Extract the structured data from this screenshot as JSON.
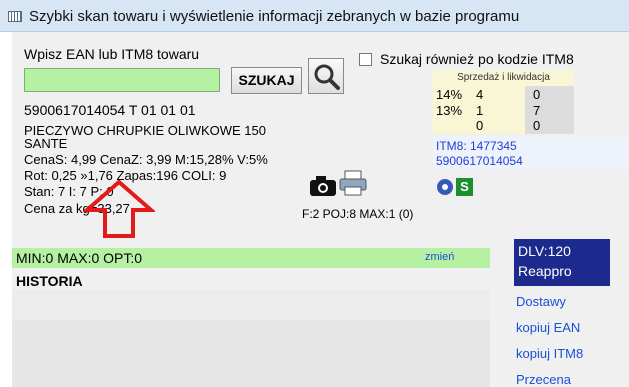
{
  "window": {
    "title": "Szybki skan towaru i wyświetlenie informacji zebranych w bazie programu"
  },
  "search": {
    "label": "Wpisz EAN lub ITM8 towaru",
    "input_value": "",
    "button_label": "SZUKAJ",
    "itm8_checkbox_label": "Szukaj również po kodzie ITM8",
    "itm8_checked": false
  },
  "product": {
    "line1": "5900617014054   T  01 01 01",
    "name": "PIECZYWO CHRUPKIE OLIWKOWE 150",
    "brand": "SANTE",
    "prices": "CenaS: 4,99   CenaZ: 3,99  M:15,28% V:5%",
    "rot": "Rot: 0,25 »1,76 Zapas:196   COLI: 9",
    "stan": "Stan: 7  I: 7  P: 0",
    "unit_price": "Cena za kg=33,27",
    "packaging": "F:2 POJ:8 MAX:1 (0)"
  },
  "sales": {
    "header": "Sprzedaż i likwidacja",
    "rows": [
      {
        "pct": "14%",
        "sold": "4",
        "liquidated": "0"
      },
      {
        "pct": "13%",
        "sold": "1",
        "liquidated": "7"
      },
      {
        "pct": "",
        "sold": "0",
        "liquidated": "0"
      }
    ]
  },
  "itm": {
    "itm8": "ITM8: 1477345",
    "ean": "5900617014054"
  },
  "status": {
    "minmax": "MIN:0 MAX:0 OPT:0",
    "change_link": "zmień",
    "s_badge": "S"
  },
  "dlv": {
    "line1": "DLV:120",
    "line2": "Reappro"
  },
  "history": {
    "title": "HISTORIA"
  },
  "actions": {
    "dostawy": "Dostawy",
    "kopiuj_ean": "kopiuj EAN",
    "kopiuj_itm8": "kopiuj ITM8",
    "przecena": "Przecena"
  },
  "colors": {
    "input_bg": "#b6f0a2",
    "sales_bg": "#f9f6d6",
    "dlv_bg": "#1c2a8e",
    "link": "#1a4fd8",
    "arrow": "#e21a1a"
  }
}
